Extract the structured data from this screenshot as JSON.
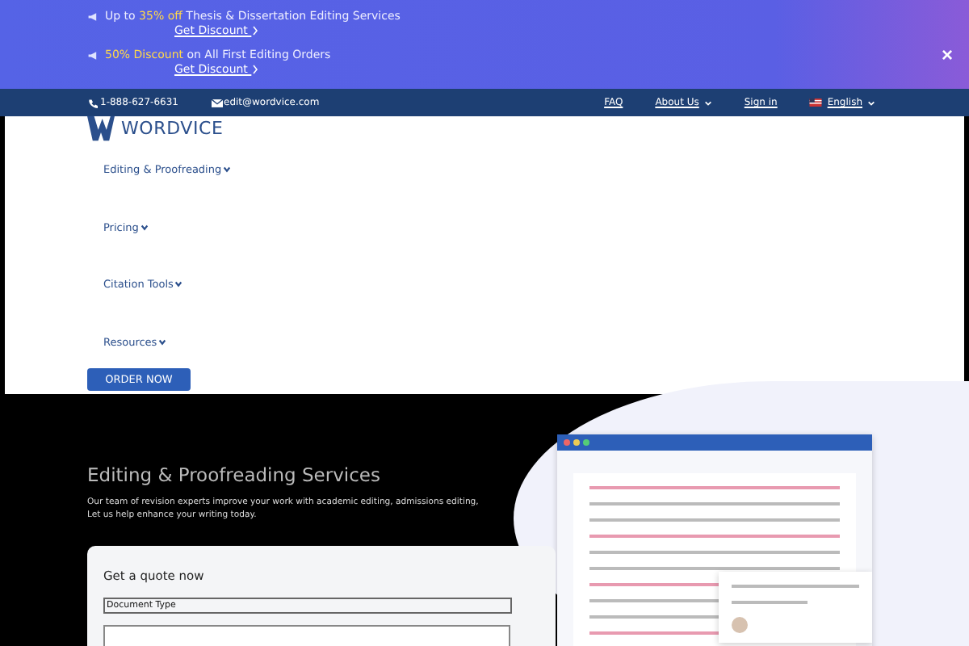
{
  "promo_banner": {
    "offers": [
      {
        "prefix": "Up to ",
        "highlight": "35% off",
        "rest": " Thesis & Dissertation Editing Services",
        "link": "Get Discount"
      },
      {
        "highlight": "50% Discount",
        "rest": " on All First Editing Orders",
        "link": "Get Discount"
      }
    ],
    "close": "×"
  },
  "top_bar": {
    "phone": "1-888-627-6631",
    "email": "edit@wordvice.com",
    "links": [
      {
        "label": "FAQ",
        "dropdown": false
      },
      {
        "label": "About Us",
        "dropdown": true
      },
      {
        "label": "Sign in",
        "dropdown": false
      }
    ],
    "language": "English"
  },
  "logo": "WORDVICE",
  "nav": [
    {
      "label": "Editing & Proofreading"
    },
    {
      "label": "Pricing"
    },
    {
      "label": "Citation Tools"
    },
    {
      "label": "Resources"
    }
  ],
  "order_button": "ORDER NOW",
  "hero": {
    "title": "Editing & Proofreading Services",
    "description": [
      "Our team of revision experts improve your work with academic editing, admissions editing,",
      "Let us help enhance your writing today."
    ]
  },
  "quote_form": {
    "title": "Get a quote now",
    "document_type": "Document Type"
  }
}
